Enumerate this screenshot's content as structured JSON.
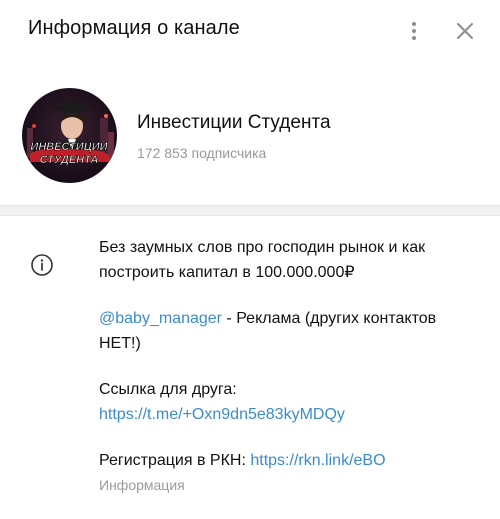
{
  "header": {
    "title": "Информация о канале",
    "menu_icon": "more-vertical-icon",
    "close_icon": "close-icon"
  },
  "channel": {
    "name": "Инвестиции Студента",
    "subscribers": "172 853 подписчика",
    "avatar_text_line1": "ИНВЕСТИЦИИ",
    "avatar_text_line2": "СТУДЕНТА"
  },
  "info": {
    "icon": "info-icon",
    "description": "Без заумных слов про господин рынок и как построить капитал в 100.000.000₽",
    "ad_mention": "@baby_manager",
    "ad_text": " - Реклама (других контактов НЕТ!)",
    "friend_label": "Ссылка для друга:",
    "friend_link": "https://t.me/+Oxn9dn5e83kyMDQy",
    "rkn_label": "Регистрация в РКН: ",
    "rkn_link": "https://rkn.link/eBO",
    "caption": "Информация"
  },
  "colors": {
    "link": "#3a8cc9",
    "muted": "#999999",
    "divider": "#f1f1f1"
  }
}
